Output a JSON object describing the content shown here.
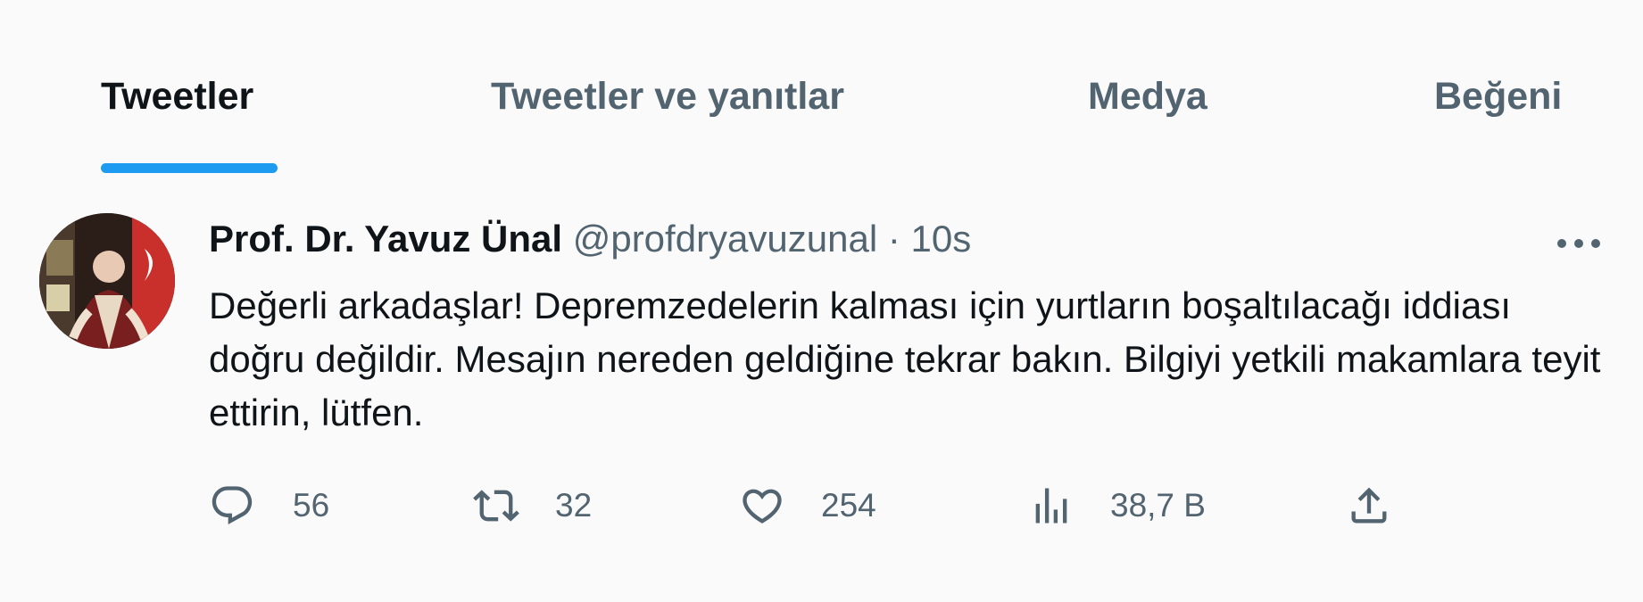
{
  "tabs": [
    {
      "label": "Tweetler",
      "active": true
    },
    {
      "label": "Tweetler ve yanıtlar",
      "active": false
    },
    {
      "label": "Medya",
      "active": false
    },
    {
      "label": "Beğeni",
      "active": false
    }
  ],
  "accent_color": "#1d9bf0",
  "tweet": {
    "author_name": "Prof. Dr. Yavuz Ünal",
    "handle": "@profdryavuzunal",
    "separator": "·",
    "time": "10s",
    "text": "Değerli arkadaşlar! Depremzedelerin kalması için yurtların boşaltılacağı iddiası doğru değildir. Mesajın nereden geldiğine tekrar bakın. Bilgiyi yetkili makamlara teyit ettirin, lütfen.",
    "replies": "56",
    "retweets": "32",
    "likes": "254",
    "views": "38,7 B"
  },
  "icons": {
    "reply": "reply-icon",
    "retweet": "retweet-icon",
    "like": "heart-icon",
    "views": "views-icon",
    "share": "share-icon",
    "more": "more-icon"
  }
}
